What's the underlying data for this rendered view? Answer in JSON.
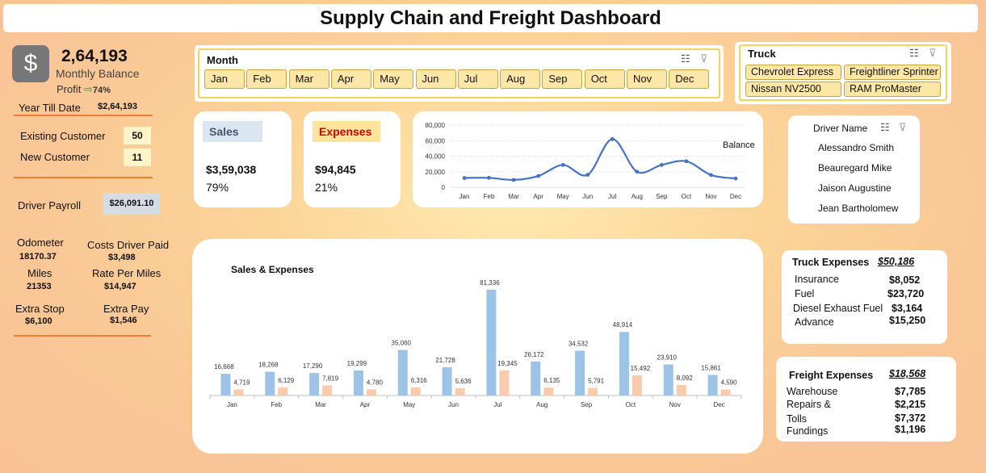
{
  "title": "Supply Chain and Freight Dashboard",
  "summary": {
    "icon": "dollar-icon",
    "monthly_balance_value": "2,64,193",
    "monthly_balance_label": "Monthly Balance",
    "profit_label": "Profit",
    "profit_arrow": "⇨",
    "profit_pct": "74%",
    "ytd_label": "Year Till Date",
    "ytd_value": "$2,64,193",
    "existing_customer_label": "Existing Customer",
    "existing_customer_value": "50",
    "new_customer_label": "New Customer",
    "new_customer_value": "11",
    "driver_payroll_label": "Driver Payroll",
    "driver_payroll_value": "$26,091.10",
    "odometer_label": "Odometer",
    "odometer_value": "18170.37",
    "costs_driver_paid_label": "Costs Driver Paid",
    "costs_driver_paid_value": "$3,498",
    "miles_label": "Miles",
    "miles_value": "21353",
    "rate_per_miles_label": "Rate Per Miles",
    "rate_per_miles_value": "$14,947",
    "extra_stop_label": "Extra Stop",
    "extra_stop_value": "$6,100",
    "extra_pay_label": "Extra Pay",
    "extra_pay_value": "$1,546"
  },
  "month_slicer": {
    "header": "Month",
    "items": [
      "Jan",
      "Feb",
      "Mar",
      "Apr",
      "May",
      "Jun",
      "Jul",
      "Aug",
      "Sep",
      "Oct",
      "Nov",
      "Dec"
    ]
  },
  "truck_slicer": {
    "header": "Truck",
    "items": [
      "Chevrolet Express",
      "Freightliner Sprinter",
      "Nissan NV2500",
      "RAM ProMaster"
    ]
  },
  "driver_slicer": {
    "header": "Driver Name",
    "items": [
      "Alessandro Smith",
      "Beauregard Mike",
      "Jaison Augustine",
      "Jean Bartholomew"
    ]
  },
  "sales_card": {
    "label": "Sales",
    "value": "$3,59,038",
    "pct": "79%",
    "color": "#dbe6f3"
  },
  "expenses_card": {
    "label": "Expenses",
    "value": "$94,845",
    "pct": "21%",
    "color": "#fde49a",
    "text_color": "#d40000"
  },
  "truck_expenses": {
    "title": "Truck Expenses",
    "total": "$50,186",
    "rows": [
      {
        "label": "Insurance",
        "value": "$8,052"
      },
      {
        "label": "Fuel",
        "value": "$23,720"
      },
      {
        "label": "Diesel Exhaust Fuel",
        "value": "$3,164"
      },
      {
        "label": "Advance",
        "value": "$15,250"
      }
    ]
  },
  "freight_expenses": {
    "title": "Freight Expenses",
    "total": "$18,568",
    "rows": [
      {
        "label": "Warehouse",
        "value": "$7,785"
      },
      {
        "label": "Repairs &",
        "value": "$2,215"
      },
      {
        "label": "Tolls",
        "value": "$7,372"
      },
      {
        "label": "Fundings",
        "value": "$1,196"
      }
    ]
  },
  "chart_data": [
    {
      "type": "line",
      "series_label": "Balance",
      "categories": [
        "Jan",
        "Feb",
        "Mar",
        "Apr",
        "May",
        "Jun",
        "Jul",
        "Aug",
        "Sep",
        "Oct",
        "Nov",
        "Dec"
      ],
      "values": [
        11949,
        12139,
        9471,
        14519,
        28744,
        16092,
        61991,
        20037,
        28741,
        33422,
        15818,
        11271
      ],
      "yticks": [
        "80,000",
        "60,000",
        "40,000",
        "20,000",
        "0"
      ],
      "ylim": [
        0,
        80000
      ],
      "line_color": "#4472c4"
    },
    {
      "type": "bar",
      "title": "Sales & Expenses",
      "categories": [
        "Jan",
        "Feb",
        "Mar",
        "Apr",
        "May",
        "Jun",
        "Jul",
        "Aug",
        "Sep",
        "Oct",
        "Nov",
        "Dec"
      ],
      "series": [
        {
          "values": [
            16668,
            18268,
            17290,
            19299,
            35060,
            21728,
            81336,
            26172,
            34532,
            48914,
            23910,
            15861
          ],
          "color": "#9dc3e6"
        },
        {
          "values": [
            4719,
            6129,
            7819,
            4780,
            6316,
            5636,
            19345,
            6135,
            5791,
            15492,
            8092,
            4590
          ],
          "color": "#f8cbad"
        }
      ],
      "labels": [
        [
          "16,668",
          "18,268",
          "17,290",
          "19,299",
          "35,060",
          "21,728",
          "81,336",
          "26,172",
          "34,532",
          "48,914",
          "23,910",
          "15,861"
        ],
        [
          "4,719",
          "6,129",
          "7,819",
          "4,780",
          "6,316",
          "5,636",
          "19,345",
          "6,135",
          "5,791",
          "15,492",
          "8,092",
          "4,590"
        ]
      ]
    }
  ]
}
